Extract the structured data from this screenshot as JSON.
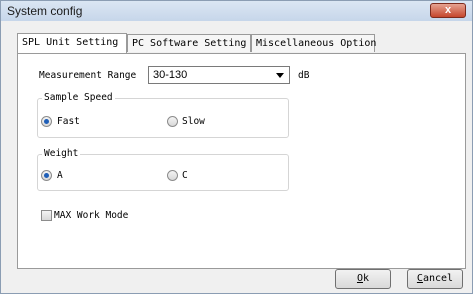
{
  "window": {
    "title": "System config",
    "close_label": "x"
  },
  "tabs": [
    {
      "label": "SPL Unit Setting"
    },
    {
      "label": "PC Software Setting"
    },
    {
      "label": "Miscellaneous Option"
    }
  ],
  "measurement": {
    "label": "Measurement Range",
    "value": "30-130",
    "unit": "dB"
  },
  "sample_speed": {
    "title": "Sample Speed",
    "options": [
      {
        "label": "Fast",
        "checked": true
      },
      {
        "label": "Slow",
        "checked": false
      }
    ]
  },
  "weight": {
    "title": "Weight",
    "options": [
      {
        "label": "A",
        "checked": true
      },
      {
        "label": "C",
        "checked": false
      }
    ]
  },
  "max_work_mode": {
    "label": "MAX Work Mode",
    "checked": false
  },
  "buttons": {
    "ok": {
      "mnemonic": "O",
      "rest": "k"
    },
    "cancel": {
      "mnemonic": "C",
      "rest": "ancel"
    }
  }
}
